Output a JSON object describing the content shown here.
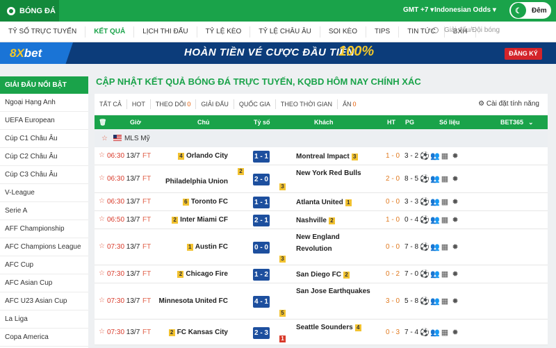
{
  "topbar": {
    "brand": "BÓNG ĐÁ",
    "timezone": "GMT +7",
    "odds": "Indonesian Odds",
    "night_label": "Đêm"
  },
  "menu": [
    {
      "label": "TỶ SỐ TRỰC TUYẾN"
    },
    {
      "label": "KẾT QUẢ",
      "active": true
    },
    {
      "label": "LỊCH THI ĐẤU"
    },
    {
      "label": "TỶ LỆ KÈO"
    },
    {
      "label": "TỶ LỆ CHÂU ÂU"
    },
    {
      "label": "SOI KÈO"
    },
    {
      "label": "TIPS"
    },
    {
      "label": "TIN TỨC"
    },
    {
      "label": "BXH"
    }
  ],
  "search": {
    "placeholder": "Giải đấu/Đội bóng"
  },
  "banner": {
    "logo_a": "8X",
    "logo_b": "bet",
    "promo": "HOÀN TIỀN VÉ CƯỢC ĐẦU TIÊN",
    "percent": "100%",
    "register": "ĐĂNG KÝ"
  },
  "sidebar": {
    "heading": "GIẢI ĐẤU NỔI BẬT",
    "items": [
      "Ngoại Hạng Anh",
      "UEFA European",
      "Cúp C1 Châu Âu",
      "Cúp C2 Châu Âu",
      "Cúp C3 Châu Âu",
      "V-League",
      "Serie A",
      "AFF Championship",
      "AFC Champions League",
      "AFC Cup",
      "AFC Asian Cup",
      "AFC U23 Asian Cup",
      "La Liga",
      "Copa America"
    ]
  },
  "page": {
    "title": "CẬP NHẬT KẾT QUẢ BÓNG ĐÁ TRỰC TUYẾN, KQBD HÔM NAY CHÍNH XÁC"
  },
  "filters": {
    "all": "TẤT CẢ",
    "hot": "HOT",
    "follow": "THEO DÕI",
    "follow_count": "0",
    "league": "GIẢI ĐẤU",
    "country": "QUỐC GIA",
    "time": "THEO THỜI GIAN",
    "hidden": "ẨN",
    "hidden_count": "0",
    "settings": "Cài đặt tính năng"
  },
  "columns": {
    "time": "Giờ",
    "home": "Chủ",
    "score": "Tỷ số",
    "away": "Khách",
    "ht": "HT",
    "pg": "PG",
    "stats": "Số liệu",
    "bookmaker": "BET365"
  },
  "league": {
    "name": "MLS Mỹ"
  },
  "matches": [
    {
      "time": "06:30",
      "date": "13/7",
      "status": "FT",
      "home": "Orlando City",
      "home_badge": "4",
      "score": "1 - 1",
      "away": "Montreal Impact",
      "away_badge": "3",
      "ht": "1 - 0",
      "pg": "3 - 2"
    },
    {
      "time": "06:30",
      "date": "13/7",
      "status": "FT",
      "home": "Philadelphia Union",
      "home_badge": "2",
      "score": "2 - 0",
      "away": "New York Red Bulls",
      "away_badge": "3",
      "ht": "2 - 0",
      "pg": "8 - 5"
    },
    {
      "time": "06:30",
      "date": "13/7",
      "status": "FT",
      "home": "Toronto FC",
      "home_badge": "6",
      "score": "1 - 1",
      "away": "Atlanta United",
      "away_badge": "1",
      "ht": "0 - 0",
      "pg": "3 - 3"
    },
    {
      "time": "06:50",
      "date": "13/7",
      "status": "FT",
      "home": "Inter Miami CF",
      "home_badge": "2",
      "score": "2 - 1",
      "away": "Nashville",
      "away_badge": "2",
      "ht": "1 - 0",
      "pg": "0 - 4"
    },
    {
      "time": "07:30",
      "date": "13/7",
      "status": "FT",
      "home": "Austin FC",
      "home_badge": "1",
      "score": "0 - 0",
      "away": "New England Revolution",
      "away_badge": "3",
      "ht": "0 - 0",
      "pg": "7 - 8"
    },
    {
      "time": "07:30",
      "date": "13/7",
      "status": "FT",
      "home": "Chicago Fire",
      "home_badge": "2",
      "score": "1 - 2",
      "away": "San Diego FC",
      "away_badge": "2",
      "ht": "0 - 2",
      "pg": "7 - 0"
    },
    {
      "time": "07:30",
      "date": "13/7",
      "status": "FT",
      "home": "Minnesota United FC",
      "home_badge": "",
      "score": "4 - 1",
      "away": "San Jose Earthquakes",
      "away_badge": "5",
      "ht": "3 - 0",
      "pg": "5 - 8"
    },
    {
      "time": "07:30",
      "date": "13/7",
      "status": "FT",
      "home": "FC Kansas City",
      "home_badge": "2",
      "score": "2 - 3",
      "away": "Seattle Sounders",
      "away_badge": "4",
      "away_red": "1",
      "ht": "0 - 3",
      "pg": "7 - 4"
    }
  ]
}
